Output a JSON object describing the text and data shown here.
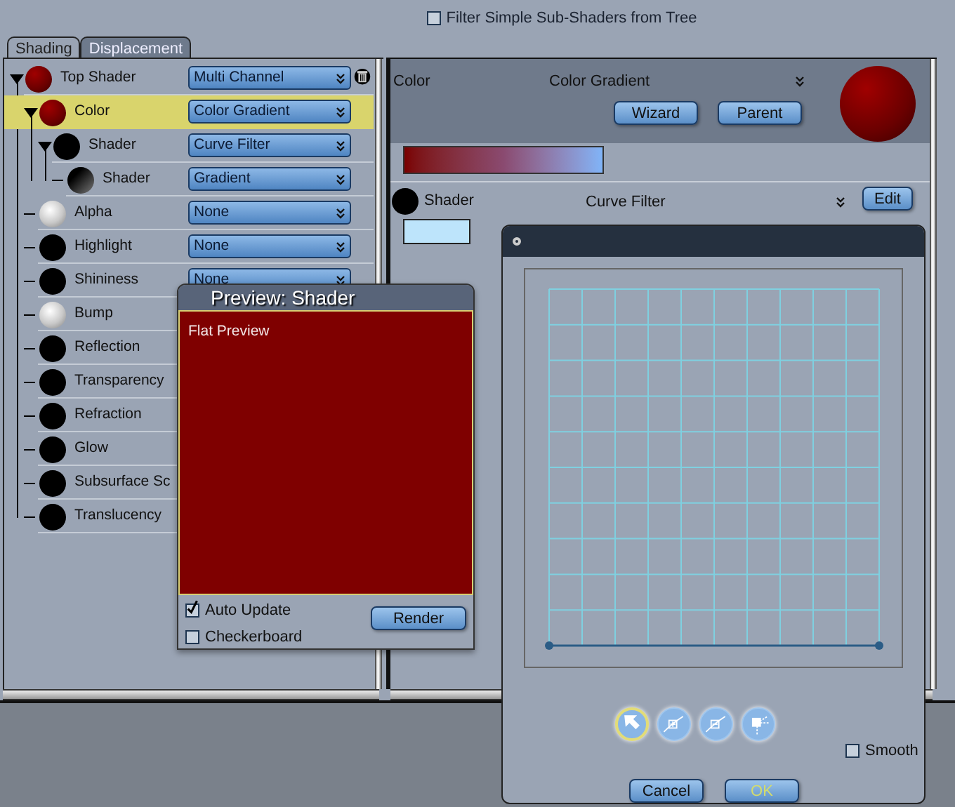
{
  "filter_checkbox": {
    "label": "Filter Simple Sub-Shaders from Tree",
    "checked": false
  },
  "tabs": [
    {
      "label": "Shading",
      "selected": true
    },
    {
      "label": "Displacement",
      "selected": false
    }
  ],
  "tree": [
    {
      "label": "Top Shader",
      "kind": "red",
      "expanded": true,
      "selected": false,
      "dropdown": "Multi Channel",
      "delete_icon": true,
      "children": [
        {
          "label": "Color",
          "kind": "red",
          "expanded": true,
          "selected": true,
          "dropdown": "Color Gradient",
          "children": [
            {
              "label": "Shader",
              "kind": "black",
              "expanded": true,
              "selected": false,
              "dropdown": "Curve Filter",
              "children": [
                {
                  "label": "Shader",
                  "kind": "fade",
                  "selected": false,
                  "dropdown": "Gradient"
                }
              ]
            }
          ]
        },
        {
          "label": "Alpha",
          "kind": "white",
          "selected": false,
          "dropdown": "None"
        },
        {
          "label": "Highlight",
          "kind": "black",
          "selected": false,
          "dropdown": "None"
        },
        {
          "label": "Shininess",
          "kind": "black",
          "selected": false,
          "dropdown": "None"
        },
        {
          "label": "Bump",
          "kind": "white",
          "selected": false
        },
        {
          "label": "Reflection",
          "kind": "black",
          "selected": false
        },
        {
          "label": "Transparency",
          "kind": "black",
          "selected": false
        },
        {
          "label": "Refraction",
          "kind": "black",
          "selected": false
        },
        {
          "label": "Glow",
          "kind": "black",
          "selected": false
        },
        {
          "label": "Subsurface Sc",
          "kind": "black",
          "selected": false
        },
        {
          "label": "Translucency",
          "kind": "black",
          "selected": false
        }
      ]
    }
  ],
  "channel": {
    "label": "Color",
    "value": "Color Gradient",
    "buttons": [
      "Wizard",
      "Parent"
    ]
  },
  "sub_shader": {
    "label": "Shader",
    "value": "Curve Filter",
    "button": "Edit"
  },
  "preview_window": {
    "title": "Preview: Shader",
    "mode": "Flat Preview",
    "checkboxes": [
      {
        "label": "Auto Update",
        "checked": true
      },
      {
        "label": "Checkerboard",
        "checked": false
      }
    ],
    "button": "Render"
  },
  "curve_dialog": {
    "tools": [
      {
        "kind": "select",
        "selected": true
      },
      {
        "kind": "add",
        "selected": false
      },
      {
        "kind": "remove",
        "selected": false
      },
      {
        "kind": "corner",
        "selected": false
      }
    ],
    "smooth": {
      "label": "Smooth",
      "checked": false
    },
    "buttons": [
      {
        "label": "Cancel",
        "kind": "cancel"
      },
      {
        "label": "OK",
        "kind": "ok"
      }
    ]
  }
}
